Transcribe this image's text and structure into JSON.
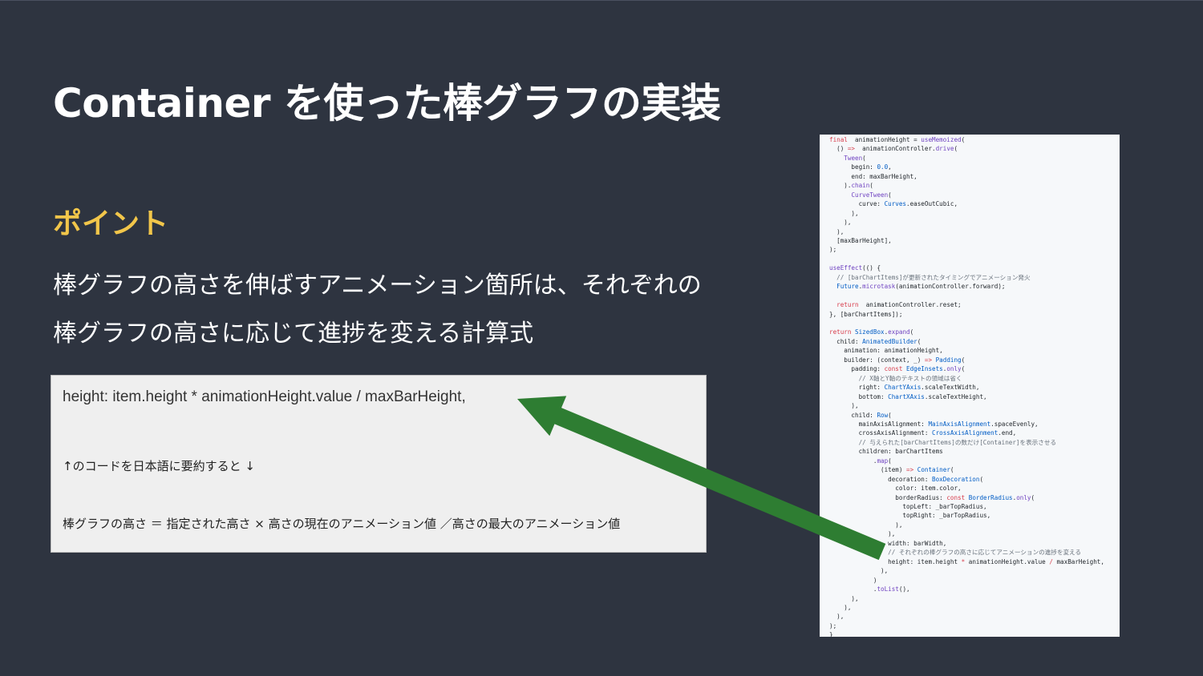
{
  "slide": {
    "title": "Container を使った棒グラフの実装",
    "point_label": "ポイント",
    "description_lines": [
      "棒グラフの高さを伸ばすアニメーション箇所は、それぞれの",
      "棒グラフの高さに応じて進捗を変える計算式"
    ]
  },
  "formula_box": {
    "code": "height: item.height * animationHeight.value / maxBarHeight,",
    "note": "↑のコードを日本語に要約すると ↓",
    "japanese_formula": "棒グラフの高さ ＝ 指定された高さ × 高さの現在のアニメーション値 ／高さの最大のアニメーション値"
  },
  "code_panel": {
    "lines": [
      [
        [
          "kw",
          "final"
        ],
        [
          "",
          "  animationHeight = "
        ],
        [
          "fn",
          "useMemoized"
        ],
        [
          "",
          "("
        ]
      ],
      [
        [
          "",
          "  () "
        ],
        [
          "kw",
          "=>"
        ],
        [
          "",
          "  animationController."
        ],
        [
          "fn",
          "drive"
        ],
        [
          "",
          "("
        ]
      ],
      [
        [
          "",
          "    "
        ],
        [
          "fn",
          "Tween"
        ],
        [
          "",
          "("
        ]
      ],
      [
        [
          "",
          "      begin: "
        ],
        [
          "ty",
          "0.0"
        ],
        [
          "",
          ","
        ]
      ],
      [
        [
          "",
          "      end: maxBarHeight,"
        ]
      ],
      [
        [
          "",
          "    )."
        ],
        [
          "fn",
          "chain"
        ],
        [
          "",
          "("
        ]
      ],
      [
        [
          "",
          "      "
        ],
        [
          "fn",
          "CurveTween"
        ],
        [
          "",
          "("
        ]
      ],
      [
        [
          "",
          "        curve: "
        ],
        [
          "ty",
          "Curves"
        ],
        [
          "",
          ".easeOutCubic,"
        ]
      ],
      [
        [
          "",
          "      ),"
        ]
      ],
      [
        [
          "",
          "    ),"
        ]
      ],
      [
        [
          "",
          "  ),"
        ]
      ],
      [
        [
          "",
          "  [maxBarHeight],"
        ]
      ],
      [
        [
          "",
          ");"
        ]
      ],
      [
        [
          "",
          ""
        ]
      ],
      [
        [
          "fn",
          "useEffect"
        ],
        [
          "",
          "(() {"
        ]
      ],
      [
        [
          "cm",
          "  // [barChartItems]が更新されたタイミングでアニメーション発火"
        ]
      ],
      [
        [
          "",
          "  "
        ],
        [
          "ty",
          "Future"
        ],
        [
          "",
          "."
        ],
        [
          "fn",
          "microtask"
        ],
        [
          "",
          "(animationController.forward);"
        ]
      ],
      [
        [
          "",
          ""
        ]
      ],
      [
        [
          "",
          "  "
        ],
        [
          "kw",
          "return"
        ],
        [
          "",
          "  animationController.reset;"
        ]
      ],
      [
        [
          "",
          "}, [barChartItems]);"
        ]
      ],
      [
        [
          "",
          ""
        ]
      ],
      [
        [
          "kw",
          "return"
        ],
        [
          "",
          " "
        ],
        [
          "ty",
          "SizedBox"
        ],
        [
          "",
          "."
        ],
        [
          "fn",
          "expand"
        ],
        [
          "",
          "("
        ]
      ],
      [
        [
          "",
          "  child: "
        ],
        [
          "ty",
          "AnimatedBuilder"
        ],
        [
          "",
          "("
        ]
      ],
      [
        [
          "",
          "    animation: animationHeight,"
        ]
      ],
      [
        [
          "",
          "    builder: (context, _) "
        ],
        [
          "kw",
          "=>"
        ],
        [
          "",
          " "
        ],
        [
          "ty",
          "Padding"
        ],
        [
          "",
          "("
        ]
      ],
      [
        [
          "",
          "      padding: "
        ],
        [
          "kw",
          "const"
        ],
        [
          "",
          " "
        ],
        [
          "ty",
          "EdgeInsets"
        ],
        [
          "",
          "."
        ],
        [
          "fn",
          "only"
        ],
        [
          "",
          "("
        ]
      ],
      [
        [
          "cm",
          "        // X軸とY軸のテキストの領域は省く"
        ]
      ],
      [
        [
          "",
          "        right: "
        ],
        [
          "ty",
          "ChartYAxis"
        ],
        [
          "",
          ".scaleTextWidth,"
        ]
      ],
      [
        [
          "",
          "        bottom: "
        ],
        [
          "ty",
          "ChartXAxis"
        ],
        [
          "",
          ".scaleTextHeight,"
        ]
      ],
      [
        [
          "",
          "      ),"
        ]
      ],
      [
        [
          "",
          "      child: "
        ],
        [
          "ty",
          "Row"
        ],
        [
          "",
          "("
        ]
      ],
      [
        [
          "",
          "        mainAxisAlignment: "
        ],
        [
          "ty",
          "MainAxisAlignment"
        ],
        [
          "",
          ".spaceEvenly,"
        ]
      ],
      [
        [
          "",
          "        crossAxisAlignment: "
        ],
        [
          "ty",
          "CrossAxisAlignment"
        ],
        [
          "",
          ".end,"
        ]
      ],
      [
        [
          "cm",
          "        // 与えられた[barChartItems]の数だけ[Container]を表示させる"
        ]
      ],
      [
        [
          "",
          "        children: barChartItems"
        ]
      ],
      [
        [
          "",
          "            ."
        ],
        [
          "fn",
          "map"
        ],
        [
          "",
          "("
        ]
      ],
      [
        [
          "",
          "              (item) "
        ],
        [
          "kw",
          "=>"
        ],
        [
          "",
          " "
        ],
        [
          "ty",
          "Container"
        ],
        [
          "",
          "("
        ]
      ],
      [
        [
          "",
          "                decoration: "
        ],
        [
          "ty",
          "BoxDecoration"
        ],
        [
          "",
          "("
        ]
      ],
      [
        [
          "",
          "                  color: item.color,"
        ]
      ],
      [
        [
          "",
          "                  borderRadius: "
        ],
        [
          "kw",
          "const"
        ],
        [
          "",
          " "
        ],
        [
          "ty",
          "BorderRadius"
        ],
        [
          "",
          "."
        ],
        [
          "fn",
          "only"
        ],
        [
          "",
          "("
        ]
      ],
      [
        [
          "",
          "                    topLeft: _barTopRadius,"
        ]
      ],
      [
        [
          "",
          "                    topRight: _barTopRadius,"
        ]
      ],
      [
        [
          "",
          "                  ),"
        ]
      ],
      [
        [
          "",
          "                ),"
        ]
      ],
      [
        [
          "",
          "                width: barWidth,"
        ]
      ],
      [
        [
          "cm",
          "                // それぞれの棒グラフの高さに応じてアニメーションの進捗を変える"
        ]
      ],
      [
        [
          "",
          "                height: item.height "
        ],
        [
          "kw",
          "*"
        ],
        [
          "",
          " animationHeight.value "
        ],
        [
          "kw",
          "/"
        ],
        [
          "",
          " maxBarHeight,"
        ]
      ],
      [
        [
          "",
          "              ),"
        ]
      ],
      [
        [
          "",
          "            )"
        ]
      ],
      [
        [
          "",
          "            ."
        ],
        [
          "fn",
          "toList"
        ],
        [
          "",
          "(),"
        ]
      ],
      [
        [
          "",
          "      ),"
        ]
      ],
      [
        [
          "",
          "    ),"
        ]
      ],
      [
        [
          "",
          "  ),"
        ]
      ],
      [
        [
          "",
          ");"
        ]
      ],
      [
        [
          "",
          "}"
        ]
      ]
    ]
  },
  "colors": {
    "background": "#2e3440",
    "title": "#ffffff",
    "point_label": "#f2c64a",
    "arrow": "#2e7d32",
    "formula_box_bg": "#efefef",
    "code_panel_bg": "#f6f8fa"
  }
}
